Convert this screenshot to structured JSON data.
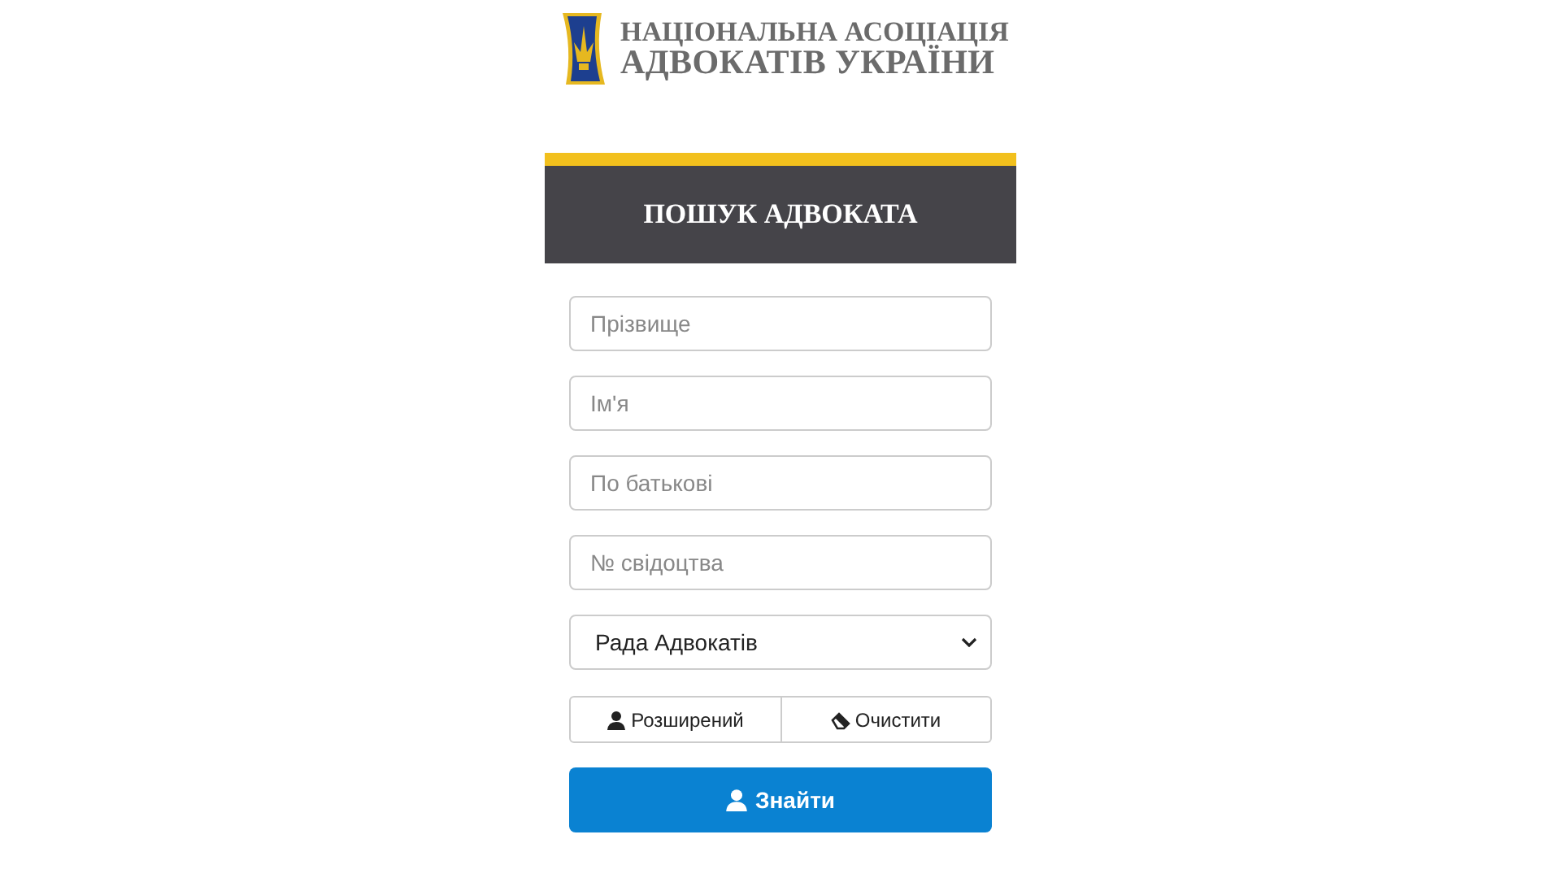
{
  "logo": {
    "line_1": "НАЦІОНАЛЬНА АСОЦІАЦІЯ",
    "line_2": "АДВОКАТІВ УКРАЇНИ"
  },
  "panel": {
    "title": "ПОШУК АДВОКАТА"
  },
  "fields": [
    {
      "placeholder": "Прізвище"
    },
    {
      "placeholder": "Ім'я"
    },
    {
      "placeholder": "По батькові"
    },
    {
      "placeholder": "№ свідоцтва"
    }
  ],
  "select": {
    "value": "Рада Адвокатів"
  },
  "buttons": [
    {
      "label": "Розширений",
      "kind": "person"
    },
    {
      "label": "Очистити",
      "kind": "eraser"
    }
  ],
  "search_button": {
    "label": "Знайти"
  }
}
